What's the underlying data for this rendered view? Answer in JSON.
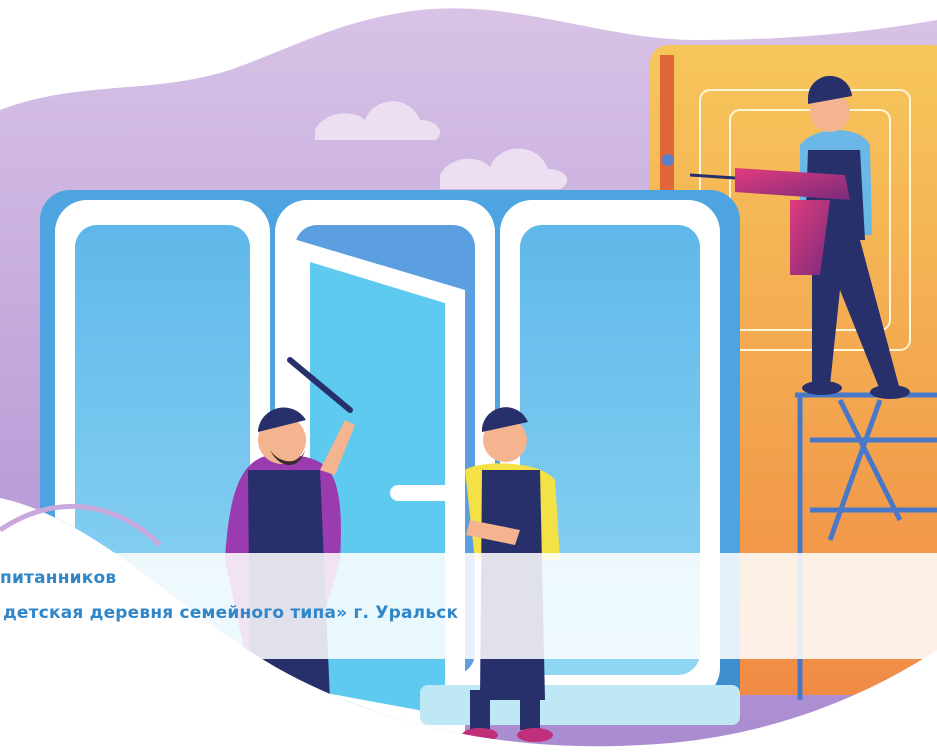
{
  "caption": {
    "line1": "питанников",
    "line2": "детская деревня семейного типа» г. Уральск"
  },
  "colors": {
    "sky_purple": "#c4a6d8",
    "window_frame": "#ffffff",
    "glass": "#6cc7ef",
    "wall_orange": "#f2a24a",
    "caption_text": "#2f86c8",
    "overalls": "#27306b"
  }
}
